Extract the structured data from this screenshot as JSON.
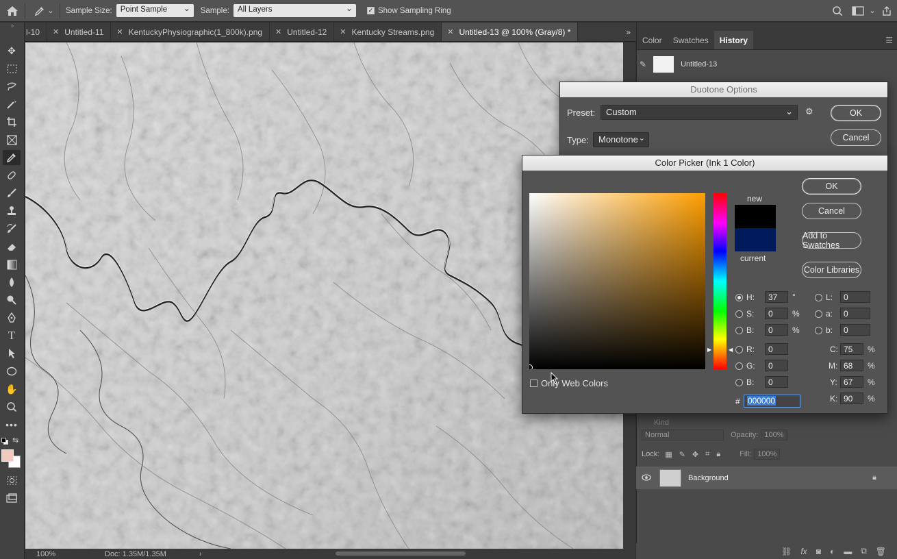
{
  "options_bar": {
    "home_icon": "home-icon",
    "tool_icon": "eyedropper-icon",
    "sample_size_label": "Sample Size:",
    "sample_size_value": "Point Sample",
    "sample_label": "Sample:",
    "sample_value": "All Layers",
    "show_ring_label": "Show Sampling Ring",
    "show_ring_checked": true
  },
  "tabs": [
    {
      "label": "l-10"
    },
    {
      "label": "Untitled-11"
    },
    {
      "label": "KentuckyPhysiographic(1_800k).png"
    },
    {
      "label": "Untitled-12"
    },
    {
      "label": "Kentucky Streams.png"
    },
    {
      "label": "Untitled-13 @ 100% (Gray/8) *"
    }
  ],
  "status": {
    "zoom": "100%",
    "doc": "Doc: 1.35M/1.35M"
  },
  "right_panel": {
    "tabs": [
      "Color",
      "Swatches",
      "History"
    ],
    "active_tab": "History",
    "history_item": "Untitled-13",
    "blend_mode": "Normal",
    "opacity_label": "Opacity:",
    "opacity_value": "100%",
    "lock_label": "Lock:",
    "fill_label": "Fill:",
    "fill_value": "100%",
    "kind_label": "Kind",
    "layer_name": "Background"
  },
  "duotone": {
    "title": "Duotone Options",
    "preset_label": "Preset:",
    "preset_value": "Custom",
    "type_label": "Type:",
    "type_value": "Monotone",
    "ok": "OK",
    "cancel": "Cancel"
  },
  "picker": {
    "title": "Color Picker (Ink 1 Color)",
    "new_label": "new",
    "current_label": "current",
    "new_color": "#000000",
    "current_color": "#001b5c",
    "ok": "OK",
    "cancel": "Cancel",
    "add_to_swatches": "Add to Swatches",
    "color_libraries": "Color Libraries",
    "only_web_colors": "Only Web Colors",
    "hsb": {
      "H": "37",
      "S": "0",
      "B": "0"
    },
    "rgb": {
      "R": "0",
      "G": "0",
      "B": "0"
    },
    "lab": {
      "L": "0",
      "a": "0",
      "b": "0"
    },
    "cmyk": {
      "C": "75",
      "M": "68",
      "Y": "67",
      "K": "90"
    },
    "hex": "000000",
    "degree": "°",
    "percent": "%"
  },
  "colors": {
    "foreground": "#f1c9bd",
    "background": "#ffffff"
  }
}
